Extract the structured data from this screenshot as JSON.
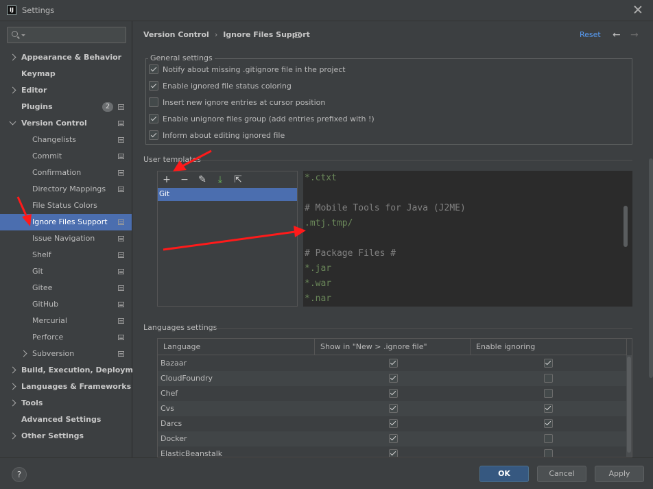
{
  "window": {
    "title": "Settings",
    "logo": "IJ"
  },
  "search": {
    "placeholder": "",
    "value": ""
  },
  "sidebar": {
    "items": [
      {
        "label": "Appearance & Behavior",
        "level": 0,
        "bold": true,
        "chevron": "right"
      },
      {
        "label": "Keymap",
        "level": 0,
        "bold": true
      },
      {
        "label": "Editor",
        "level": 0,
        "bold": true,
        "chevron": "right"
      },
      {
        "label": "Plugins",
        "level": 0,
        "bold": true,
        "badge": "2",
        "proj": true
      },
      {
        "label": "Version Control",
        "level": 0,
        "bold": true,
        "chevron": "down",
        "proj": true
      },
      {
        "label": "Changelists",
        "level": 1,
        "proj": true
      },
      {
        "label": "Commit",
        "level": 1,
        "proj": true
      },
      {
        "label": "Confirmation",
        "level": 1,
        "proj": true
      },
      {
        "label": "Directory Mappings",
        "level": 1,
        "proj": true
      },
      {
        "label": "File Status Colors",
        "level": 1
      },
      {
        "label": "Ignore Files Support",
        "level": 1,
        "proj": true,
        "selected": true
      },
      {
        "label": "Issue Navigation",
        "level": 1,
        "proj": true
      },
      {
        "label": "Shelf",
        "level": 1,
        "proj": true
      },
      {
        "label": "Git",
        "level": 1,
        "proj": true
      },
      {
        "label": "Gitee",
        "level": 1,
        "proj": true
      },
      {
        "label": "GitHub",
        "level": 1,
        "proj": true
      },
      {
        "label": "Mercurial",
        "level": 1,
        "proj": true
      },
      {
        "label": "Perforce",
        "level": 1,
        "proj": true
      },
      {
        "label": "Subversion",
        "level": 1,
        "chevron": "right",
        "proj": true
      },
      {
        "label": "Build, Execution, Deployment",
        "level": 0,
        "bold": true,
        "chevron": "right"
      },
      {
        "label": "Languages & Frameworks",
        "level": 0,
        "bold": true,
        "chevron": "right"
      },
      {
        "label": "Tools",
        "level": 0,
        "bold": true,
        "chevron": "right"
      },
      {
        "label": "Advanced Settings",
        "level": 0,
        "bold": true
      },
      {
        "label": "Other Settings",
        "level": 0,
        "bold": true,
        "chevron": "right"
      }
    ]
  },
  "header": {
    "crumb_parent": "Version Control",
    "crumb_separator": "›",
    "crumb_current": "Ignore Files Support",
    "reset": "Reset",
    "back": "←",
    "forward": "→"
  },
  "general": {
    "title": "General settings",
    "options": [
      {
        "label": "Notify about missing .gitignore file in the project",
        "checked": true
      },
      {
        "label": "Enable ignored file status coloring",
        "checked": true
      },
      {
        "label": "Insert new ignore entries at cursor position",
        "checked": false
      },
      {
        "label": "Enable unignore files group (add entries prefixed with !)",
        "checked": true
      },
      {
        "label": "Inform about editing ignored file",
        "checked": true
      }
    ]
  },
  "templates": {
    "title": "User templates",
    "toolbar": {
      "add": "+",
      "remove": "−",
      "edit": "✎",
      "import": "⤓",
      "export": "⇱"
    },
    "items": [
      "Git"
    ],
    "code": [
      {
        "text": "*.ctxt",
        "style": "green"
      },
      {
        "text": "",
        "style": "green"
      },
      {
        "text": "# Mobile Tools for Java (J2ME)",
        "style": "comment"
      },
      {
        "text": ".mtj.tmp/",
        "style": "green"
      },
      {
        "text": "",
        "style": "green"
      },
      {
        "text": "# Package Files #",
        "style": "comment"
      },
      {
        "text": "*.jar",
        "style": "green"
      },
      {
        "text": "*.war",
        "style": "green"
      },
      {
        "text": "*.nar",
        "style": "green"
      }
    ]
  },
  "languages": {
    "title": "Languages settings",
    "columns": [
      "Language",
      "Show in \"New > .ignore file\"",
      "Enable ignoring"
    ],
    "rows": [
      {
        "name": "Bazaar",
        "show": true,
        "enable": true
      },
      {
        "name": "CloudFoundry",
        "show": true,
        "enable": false
      },
      {
        "name": "Chef",
        "show": true,
        "enable": false
      },
      {
        "name": "Cvs",
        "show": true,
        "enable": true
      },
      {
        "name": "Darcs",
        "show": true,
        "enable": true
      },
      {
        "name": "Docker",
        "show": true,
        "enable": false
      },
      {
        "name": "ElasticBeanstalk",
        "show": true,
        "enable": false
      }
    ]
  },
  "footer": {
    "help": "?",
    "ok": "OK",
    "cancel": "Cancel",
    "apply": "Apply"
  },
  "colors": {
    "accent": "#4b6eaf",
    "link": "#589df6",
    "annotation": "#ff1a1a"
  }
}
